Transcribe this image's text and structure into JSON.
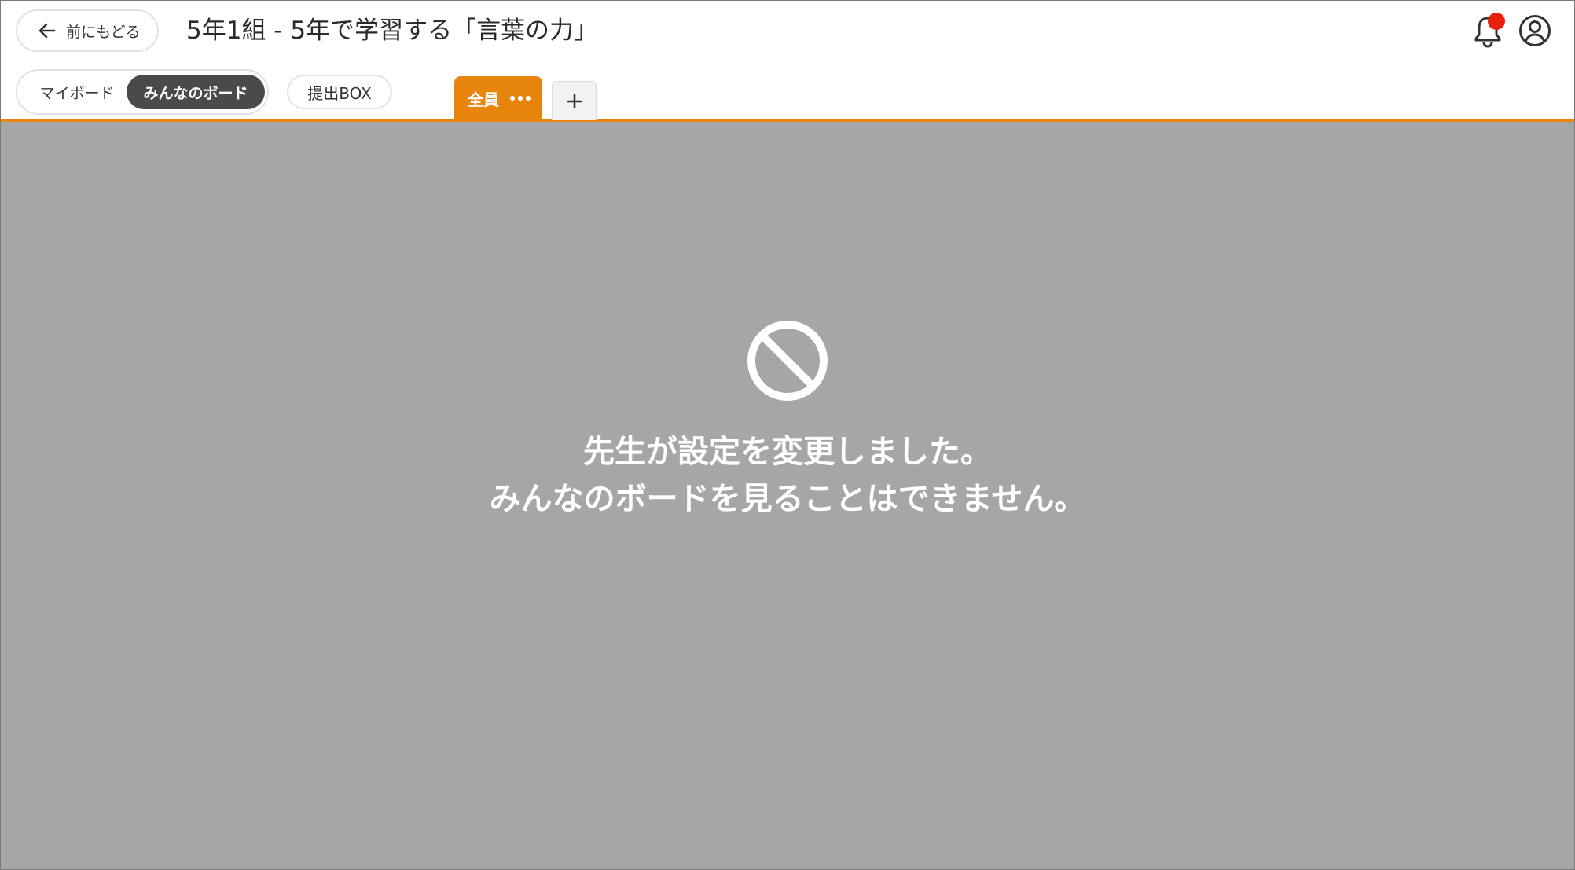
{
  "header": {
    "back_label": "前にもどる",
    "title": "5年1組 - 5年で学習する「言葉の力」",
    "notification_badge": true,
    "colors": {
      "accent": "#e8850c",
      "badge": "#e8210c",
      "active_segment": "#4a4a4a"
    }
  },
  "board_switch": {
    "items": [
      {
        "label": "マイボード",
        "selected": false
      },
      {
        "label": "みんなのボード",
        "selected": true
      }
    ]
  },
  "submit_box": {
    "label": "提出BOX"
  },
  "tabs": {
    "active": {
      "label": "全員",
      "icon": "more-dots-icon"
    },
    "add_icon": "plus-icon"
  },
  "overlay": {
    "icon": "prohibited-icon",
    "line1": "先生が設定を変更しました。",
    "line2": "みんなのボードを見ることはできません。",
    "background": "#a6a6a6"
  }
}
